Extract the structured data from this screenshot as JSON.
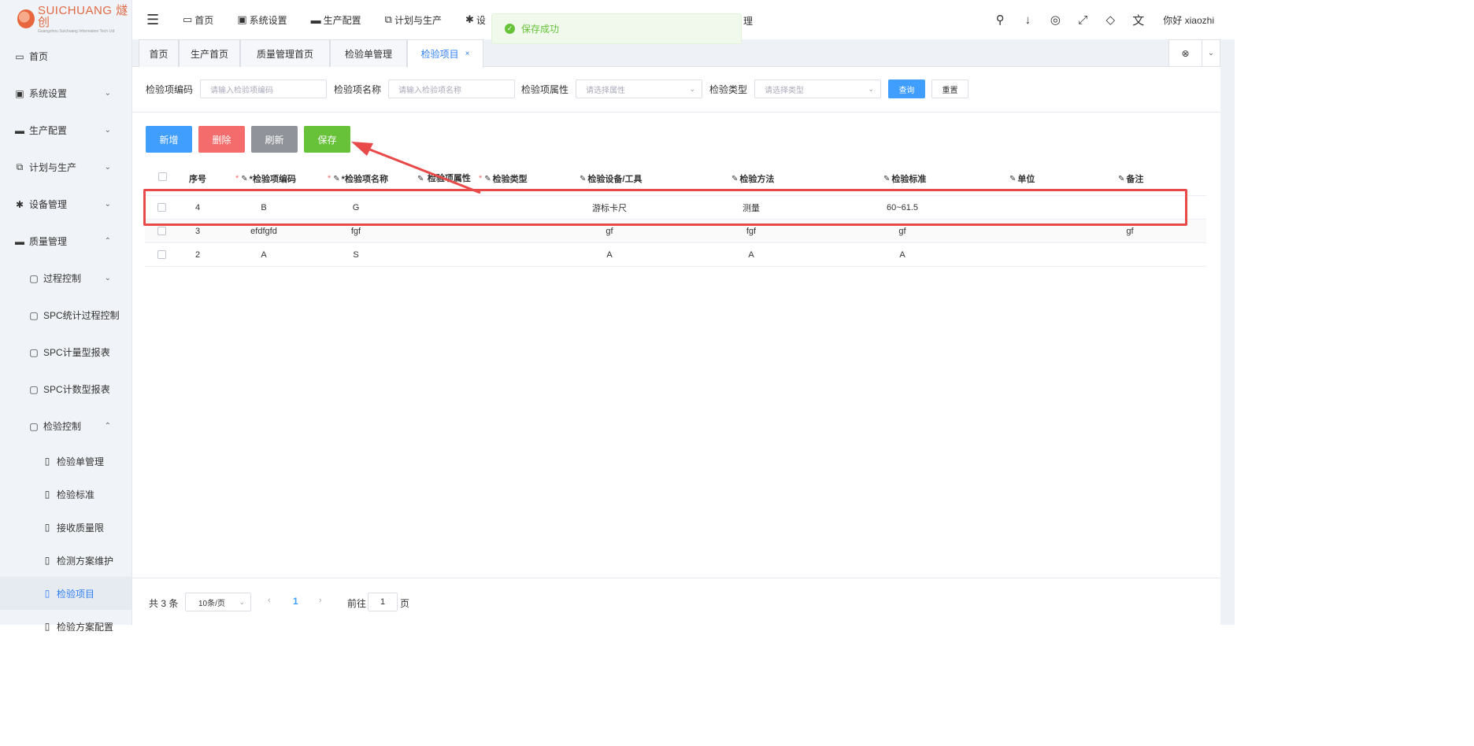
{
  "logo": {
    "main": "SUICHUANG 燧创",
    "sub": "Guangzhou Suichuang Information Tech Ltd"
  },
  "sidebar": {
    "items": [
      {
        "label": "首页",
        "icon": "monitor-icon",
        "glyph": "▭",
        "chevron": ""
      },
      {
        "label": "系统设置",
        "icon": "user-card-icon",
        "glyph": "▣",
        "chevron": "⌄"
      },
      {
        "label": "生产配置",
        "icon": "briefcase-icon",
        "glyph": "▬",
        "chevron": "⌄"
      },
      {
        "label": "计划与生产",
        "icon": "windows-icon",
        "glyph": "⧉",
        "chevron": "⌄"
      },
      {
        "label": "设备管理",
        "icon": "asterisk-icon",
        "glyph": "✱",
        "chevron": "⌄"
      },
      {
        "label": "质量管理",
        "icon": "briefcase-icon",
        "glyph": "▬",
        "chevron": "⌃"
      },
      {
        "label": "过程控制",
        "icon": "folder-icon",
        "glyph": "▢",
        "chevron": "⌄"
      },
      {
        "label": "SPC统计过程控制",
        "icon": "folder-icon",
        "glyph": "▢",
        "chevron": ""
      },
      {
        "label": "SPC计量型报表",
        "icon": "folder-icon",
        "glyph": "▢",
        "chevron": "✓"
      },
      {
        "label": "SPC计数型报表",
        "icon": "folder-icon",
        "glyph": "▢",
        "chevron": "✓"
      },
      {
        "label": "检验控制",
        "icon": "folder-icon",
        "glyph": "▢",
        "chevron": "⌃"
      },
      {
        "label": "检验单管理",
        "icon": "file-icon",
        "glyph": "▯",
        "chevron": ""
      },
      {
        "label": "检验标准",
        "icon": "file-icon",
        "glyph": "▯",
        "chevron": ""
      },
      {
        "label": "接收质量限",
        "icon": "file-icon",
        "glyph": "▯",
        "chevron": ""
      },
      {
        "label": "检测方案维护",
        "icon": "file-icon",
        "glyph": "▯",
        "chevron": ""
      },
      {
        "label": "检验项目",
        "icon": "file-icon",
        "glyph": "▯",
        "chevron": ""
      },
      {
        "label": "检验方案配置",
        "icon": "file-icon",
        "glyph": "▯",
        "chevron": ""
      }
    ]
  },
  "topnav": {
    "menu_icon": "☰",
    "items": [
      {
        "label": "首页",
        "icon": "monitor-icon",
        "glyph": "▭"
      },
      {
        "label": "系统设置",
        "icon": "user-card-icon",
        "glyph": "▣"
      },
      {
        "label": "生产配置",
        "icon": "briefcase-icon",
        "glyph": "▬"
      },
      {
        "label": "计划与生产",
        "icon": "windows-icon",
        "glyph": "⧉"
      },
      {
        "label": "设",
        "icon": "asterisk-icon",
        "glyph": "✱"
      }
    ],
    "hidden_item_tail": "理",
    "right_icons": [
      {
        "name": "search-icon",
        "glyph": "⚲"
      },
      {
        "name": "download-icon",
        "glyph": "↓"
      },
      {
        "name": "target-icon",
        "glyph": "◎"
      },
      {
        "name": "fullscreen-icon",
        "glyph": "⤢"
      },
      {
        "name": "diamond-icon",
        "glyph": "◇"
      },
      {
        "name": "translate-icon",
        "glyph": "文"
      }
    ],
    "greeting": "你好 xiaozhi"
  },
  "toast": {
    "text": "保存成功",
    "check": "✓"
  },
  "tabs": [
    {
      "label": "首页",
      "active": false
    },
    {
      "label": "生产首页",
      "active": false
    },
    {
      "label": "质量管理首页",
      "active": false
    },
    {
      "label": "检验单管理",
      "active": false
    },
    {
      "label": "检验项目",
      "active": true,
      "close": "×"
    }
  ],
  "tabs_ctrl": {
    "close_all": "⊗",
    "dropdown": "⌄"
  },
  "filter": {
    "code_label": "检验项编码",
    "code_placeholder": "请输入检验项编码",
    "name_label": "检验项名称",
    "name_placeholder": "请输入检验项名称",
    "attr_label": "检验项属性",
    "attr_placeholder": "请选择属性",
    "type_label": "检验类型",
    "type_placeholder": "请选择类型",
    "query": "查询",
    "reset": "重置",
    "arrow": "⌄"
  },
  "actions": {
    "add": "新增",
    "delete": "删除",
    "refresh": "刷新",
    "save": "保存",
    "colors": {
      "add": "#409eff",
      "delete": "#f56c6c",
      "refresh": "#909399",
      "save": "#67c23a"
    }
  },
  "table": {
    "edit_icon": "✎",
    "required_mark": "*",
    "columns": [
      {
        "key": "seq",
        "label": "序号"
      },
      {
        "key": "code",
        "label": "*检验项编码",
        "required": true,
        "editable": true
      },
      {
        "key": "name",
        "label": "*检验项名称",
        "required": true,
        "editable": true
      },
      {
        "key": "attr",
        "label": "检验项属性",
        "required": false,
        "editable": true
      },
      {
        "key": "type",
        "label": "检验类型",
        "required": true,
        "editable": true
      },
      {
        "key": "device",
        "label": "检验设备/工具",
        "required": false,
        "editable": true
      },
      {
        "key": "method",
        "label": "检验方法",
        "required": false,
        "editable": true
      },
      {
        "key": "standard",
        "label": "检验标准",
        "required": false,
        "editable": true
      },
      {
        "key": "unit",
        "label": "单位",
        "required": false,
        "editable": true
      },
      {
        "key": "remark",
        "label": "备注",
        "required": false,
        "editable": true
      }
    ],
    "rows": [
      {
        "seq": "4",
        "code": "B",
        "name": "G",
        "attr": "",
        "type": "",
        "device": "游标卡尺",
        "method": "测量",
        "standard": "60~61.5",
        "unit": "",
        "remark": ""
      },
      {
        "seq": "3",
        "code": "efdfgfd",
        "name": "fgf",
        "attr": "",
        "type": "",
        "device": "gf",
        "method": "fgf",
        "standard": "gf",
        "unit": "",
        "remark": "gf"
      },
      {
        "seq": "2",
        "code": "A",
        "name": "S",
        "attr": "",
        "type": "",
        "device": "A",
        "method": "A",
        "standard": "A",
        "unit": "",
        "remark": ""
      }
    ]
  },
  "pagination": {
    "total": "共 3 条",
    "page_size": "10条/页",
    "prev": "‹",
    "current": "1",
    "next": "›",
    "goto_label": "前往",
    "goto_value": "1",
    "page_suffix": "页"
  },
  "annotation_color": "#e84a4a"
}
